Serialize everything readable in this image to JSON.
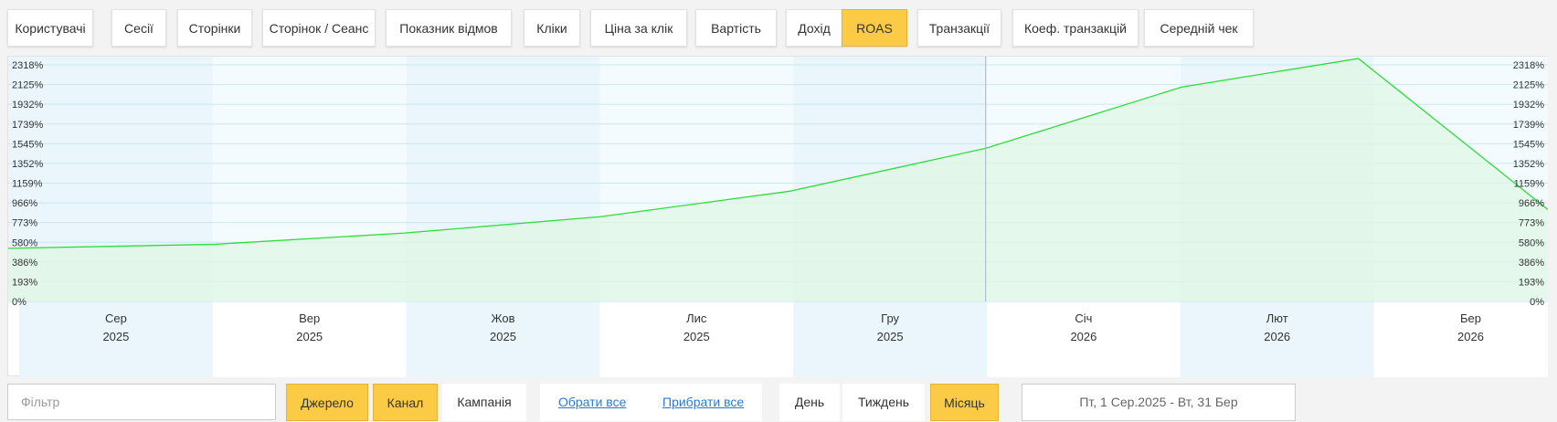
{
  "tabs": [
    {
      "label": "Користувачі",
      "active": false
    },
    {
      "label": "Сесії",
      "active": false
    },
    {
      "label": "Сторінки",
      "active": false
    },
    {
      "label": "Сторінок / Сеанс",
      "active": false
    },
    {
      "label": "Показник відмов",
      "active": false
    },
    {
      "label": "Кліки",
      "active": false
    },
    {
      "label": "Ціна за клік",
      "active": false
    },
    {
      "label": "Вартість",
      "active": false
    },
    {
      "label": "Дохід",
      "active": false
    },
    {
      "label": "ROAS",
      "active": true
    },
    {
      "label": "Транзакції",
      "active": false
    },
    {
      "label": "Коеф. транзакцій",
      "active": false
    },
    {
      "label": "Середній чек",
      "active": false
    }
  ],
  "chart_data": {
    "type": "area",
    "categories": [
      {
        "month": "Сер",
        "year": "2025"
      },
      {
        "month": "Вер",
        "year": "2025"
      },
      {
        "month": "Жов",
        "year": "2025"
      },
      {
        "month": "Лис",
        "year": "2025"
      },
      {
        "month": "Гру",
        "year": "2025"
      },
      {
        "month": "Січ",
        "year": "2026"
      },
      {
        "month": "Лют",
        "year": "2026"
      },
      {
        "month": "Бер",
        "year": "2026"
      }
    ],
    "series": [
      {
        "color": "#2edc3a",
        "fill": "#dff7e4",
        "x": [
          "2025-08-01",
          "2025-09-01",
          "2025-10-01",
          "2025-11-01",
          "2025-12-01",
          "2026-01-01",
          "2026-02-01",
          "2026-03-01",
          "2026-03-31"
        ],
        "values": [
          520,
          560,
          670,
          830,
          1080,
          1500,
          2100,
          2380,
          900
        ]
      }
    ],
    "yticks": [
      "0%",
      "193%",
      "386%",
      "580%",
      "773%",
      "966%",
      "1159%",
      "1352%",
      "1545%",
      "1739%",
      "1932%",
      "2125%",
      "2318%"
    ],
    "ylim": [
      0,
      2318
    ],
    "grid": true,
    "crosshair_x": "2026-01-01"
  },
  "controls": {
    "filter_placeholder": "Фільтр",
    "group_buttons": [
      {
        "label": "Джерело",
        "active": true
      },
      {
        "label": "Канал",
        "active": true
      },
      {
        "label": "Кампанія",
        "active": false
      }
    ],
    "select_all": "Обрати все",
    "clear_all": "Прибрати все",
    "period_buttons": [
      {
        "label": "День",
        "active": false
      },
      {
        "label": "Тиждень",
        "active": false
      },
      {
        "label": "Місяць",
        "active": true
      }
    ],
    "date_range": "Пт, 1 Сер.2025 - Вт, 31 Бер"
  }
}
